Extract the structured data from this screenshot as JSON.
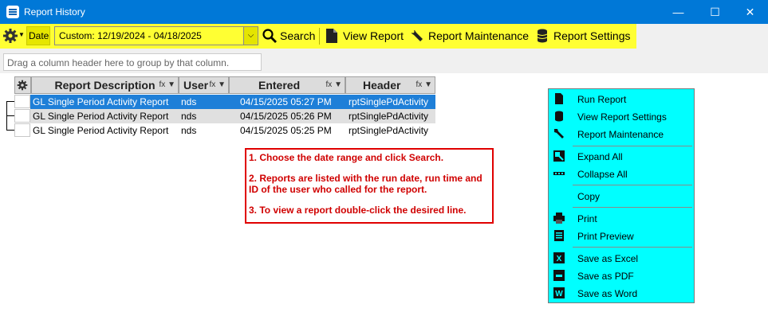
{
  "window": {
    "title": "Report History",
    "minimize_glyph": "—",
    "maximize_glyph": "☐",
    "close_glyph": "✕"
  },
  "toolbar": {
    "settings_icon": "gear-icon",
    "date_label": "Date",
    "date_range_value": "Custom: 12/19/2024 - 04/18/2025",
    "dropdown_glyph": "⌵",
    "search_label": "Search",
    "view_report_label": "View Report",
    "report_maintenance_label": "Report Maintenance",
    "report_settings_label": "Report Settings",
    "highlight_color": "#ffff33"
  },
  "group_panel": {
    "placeholder": "Drag a column header here to group by that column."
  },
  "grid": {
    "columns": [
      {
        "label": "Report Description",
        "filter": "fx ▼"
      },
      {
        "label": "User",
        "filter": "fx ▼"
      },
      {
        "label": "Entered",
        "filter": "fx ▼"
      },
      {
        "label": "Header",
        "filter": "fx ▼"
      }
    ],
    "rows": [
      {
        "description": "GL Single Period Activity Report",
        "user": "nds",
        "entered": "04/15/2025 05:27 PM",
        "header": "rptSinglePdActivity",
        "selected": true
      },
      {
        "description": "GL Single Period Activity Report",
        "user": "nds",
        "entered": "04/15/2025 05:26 PM",
        "header": "rptSinglePdActivity",
        "selected": false
      },
      {
        "description": "GL Single Period Activity Report",
        "user": "nds",
        "entered": "04/15/2025 05:25 PM",
        "header": "rptSinglePdActivity",
        "selected": false
      }
    ],
    "selected_row_color": "#1e7fd8"
  },
  "notes": {
    "step1": "1.  Choose the date range and click Search.",
    "step2": "2.  Reports are listed with the run date, run time and ID of the user who called for the report.",
    "step3": "3.  To view a report double-click the desired line."
  },
  "context_menu": {
    "background_color": "#00ffff",
    "items": [
      {
        "label": "Run Report",
        "icon": "report-icon"
      },
      {
        "label": "View Report Settings",
        "icon": "database-icon"
      },
      {
        "label": "Report Maintenance",
        "icon": "wrench-icon"
      },
      {
        "label": "Expand All",
        "icon": "expand-all-icon"
      },
      {
        "label": "Collapse All",
        "icon": "collapse-all-icon"
      },
      {
        "label": "Copy",
        "icon": "copy-icon"
      },
      {
        "label": "Print",
        "icon": "printer-icon"
      },
      {
        "label": "Print Preview",
        "icon": "print-preview-icon"
      },
      {
        "label": "Save as Excel",
        "icon": "excel-icon"
      },
      {
        "label": "Save as PDF",
        "icon": "pdf-icon"
      },
      {
        "label": "Save as Word",
        "icon": "word-icon"
      }
    ]
  }
}
